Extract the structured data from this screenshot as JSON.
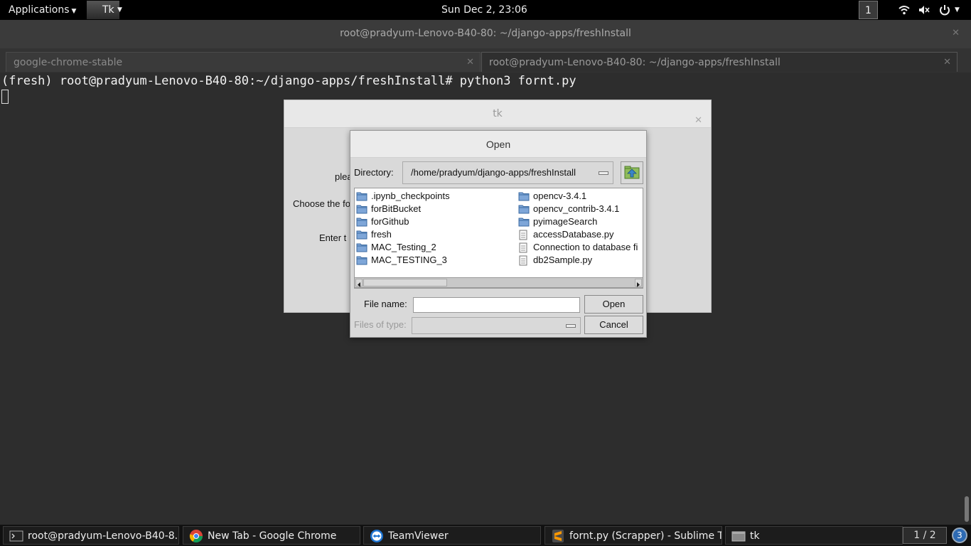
{
  "topbar": {
    "applications_label": "Applications",
    "app_menu_label": "Tk",
    "clock": "Sun Dec  2, 23:06",
    "workspace": "1"
  },
  "terminal": {
    "window_title": "root@pradyum-Lenovo-B40-80: ~/django-apps/freshInstall",
    "tabs": [
      {
        "label": "google-chrome-stable"
      },
      {
        "label": "root@pradyum-Lenovo-B40-80: ~/django-apps/freshInstall"
      }
    ],
    "line1": "(fresh) root@pradyum-Lenovo-B40-80:~/django-apps/freshInstall# python3 fornt.py"
  },
  "tk_window": {
    "title": "tk",
    "label_please": "plea",
    "label_choose": "Choose the fo",
    "label_enter": "Enter t"
  },
  "open_dialog": {
    "title": "Open",
    "directory_label": "Directory:",
    "directory_value": "/home/pradyum/django-apps/freshInstall",
    "files_col1": [
      {
        "name": ".ipynb_checkpoints",
        "type": "folder"
      },
      {
        "name": "forBitBucket",
        "type": "folder"
      },
      {
        "name": "forGithub",
        "type": "folder"
      },
      {
        "name": "fresh",
        "type": "folder"
      },
      {
        "name": "MAC_Testing_2",
        "type": "folder"
      },
      {
        "name": "MAC_TESTING_3",
        "type": "folder"
      }
    ],
    "files_col2": [
      {
        "name": "opencv-3.4.1",
        "type": "folder"
      },
      {
        "name": "opencv_contrib-3.4.1",
        "type": "folder"
      },
      {
        "name": "pyimageSearch",
        "type": "folder"
      },
      {
        "name": "accessDatabase.py",
        "type": "file"
      },
      {
        "name": "Connection to database fi",
        "type": "file"
      },
      {
        "name": "db2Sample.py",
        "type": "file"
      }
    ],
    "file_name_label": "File name:",
    "file_name_value": "",
    "files_of_type_label": "Files of type:",
    "open_button": "Open",
    "cancel_button": "Cancel"
  },
  "taskbar": {
    "tasks": [
      {
        "label": "root@pradyum-Lenovo-B40-8...",
        "icon": "terminal-icon"
      },
      {
        "label": "New Tab - Google Chrome",
        "icon": "chrome-icon"
      },
      {
        "label": "TeamViewer",
        "icon": "teamviewer-icon"
      },
      {
        "label": "fornt.py (Scrapper) - Sublime Te...",
        "icon": "sublime-icon"
      },
      {
        "label": "tk",
        "icon": "tk-window-icon"
      }
    ],
    "pager": "1 / 2",
    "notifications": "3"
  },
  "colors": {
    "folder": "#7ea6d8",
    "dialog_bg": "#d9d9d9",
    "terminal_bg": "#2d2d2d"
  }
}
